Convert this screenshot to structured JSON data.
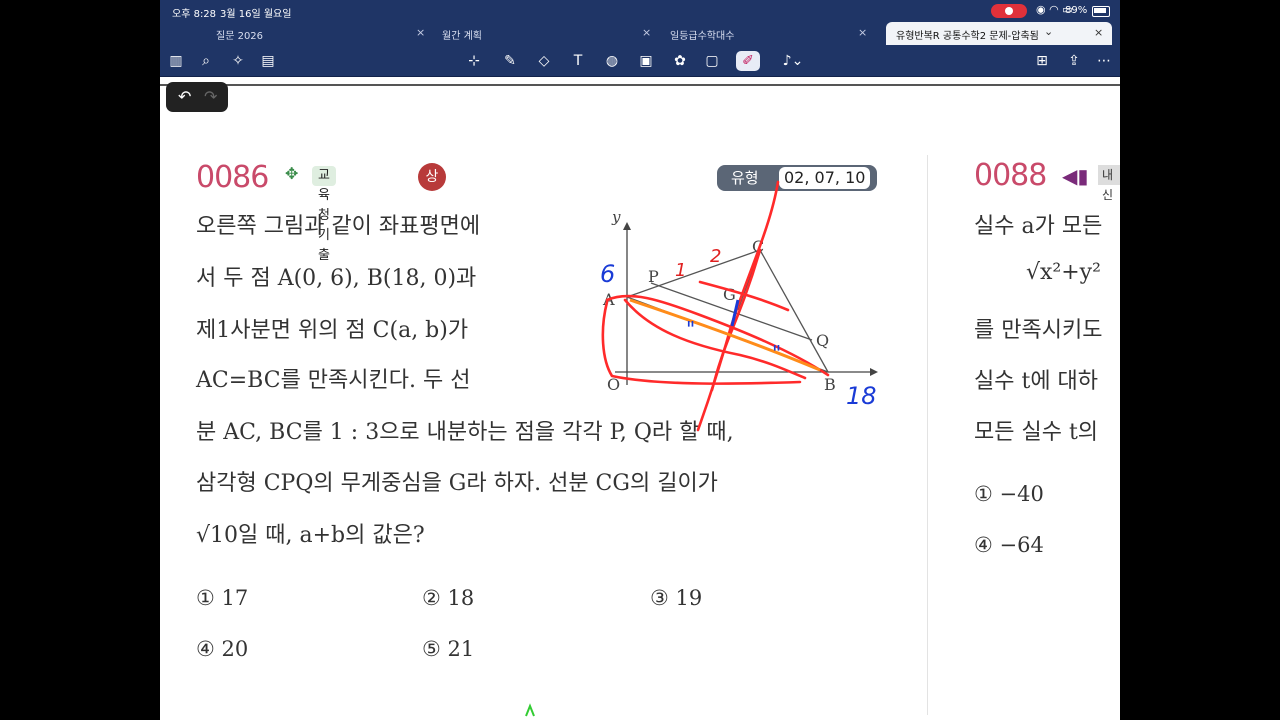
{
  "status": {
    "time": "오후 8:28",
    "date": "3월 16일 월요일",
    "battery": "89%"
  },
  "tabs": [
    {
      "label": "질문 2026"
    },
    {
      "label": "월간 계획"
    },
    {
      "label": "일등급수학대수"
    },
    {
      "label": "유형반복R 공통수학2 문제-압축됨"
    }
  ],
  "tab_close": "×",
  "active_chevron": "⌄",
  "toolbar_icons": [
    "sidebar-icon",
    "search-icon",
    "sparkle-icon",
    "document-icon",
    "lasso-icon",
    "pen-icon",
    "eraser-icon",
    "textbox-icon",
    "shapes-icon",
    "image-icon",
    "elements-icon",
    "sticky-note-icon",
    "laser-pointer-icon",
    "microphone-icon",
    "add-page-icon",
    "share-icon",
    "more-icon"
  ],
  "accent": "#c94a6a",
  "problem": {
    "number": "0086",
    "source_badge": "교육청 기출",
    "level": "상",
    "type_label": "유형",
    "type_refs": "02, 07, 10",
    "lines": [
      "오른쪽 그림과 같이 좌표평면에",
      "서 두 점 A(0, 6), B(18, 0)과",
      "제1사분면 위의 점 C(a, b)가",
      "AC=BC를 만족시킨다. 두 선",
      "분 AC, BC를 1 : 3으로 내분하는 점을 각각 P, Q라 할 때,",
      "삼각형 CPQ의 무게중심을 G라 하자. 선분 CG의 길이가",
      "√10일 때, a+b의 값은?"
    ],
    "choices": [
      "① 17",
      "② 18",
      "③ 19",
      "④ 20",
      "⑤ 21"
    ]
  },
  "figure_labels": {
    "y": "y",
    "A": "A",
    "P": "P",
    "C": "C",
    "G": "G",
    "Q": "Q",
    "O": "O",
    "B": "B",
    "hand_6": "6",
    "hand_18": "18",
    "hand_1": "1",
    "hand_2": "2",
    "hand_tick": "\""
  },
  "next_problem": {
    "number": "0088",
    "badge_partial": "내신",
    "lines": [
      "실수 a가 모든",
      "√x²+y²",
      "를 만족시키도",
      "실수 t에 대하",
      "모든 실수 t의"
    ],
    "choices": [
      "① −40",
      "④ −64"
    ]
  }
}
